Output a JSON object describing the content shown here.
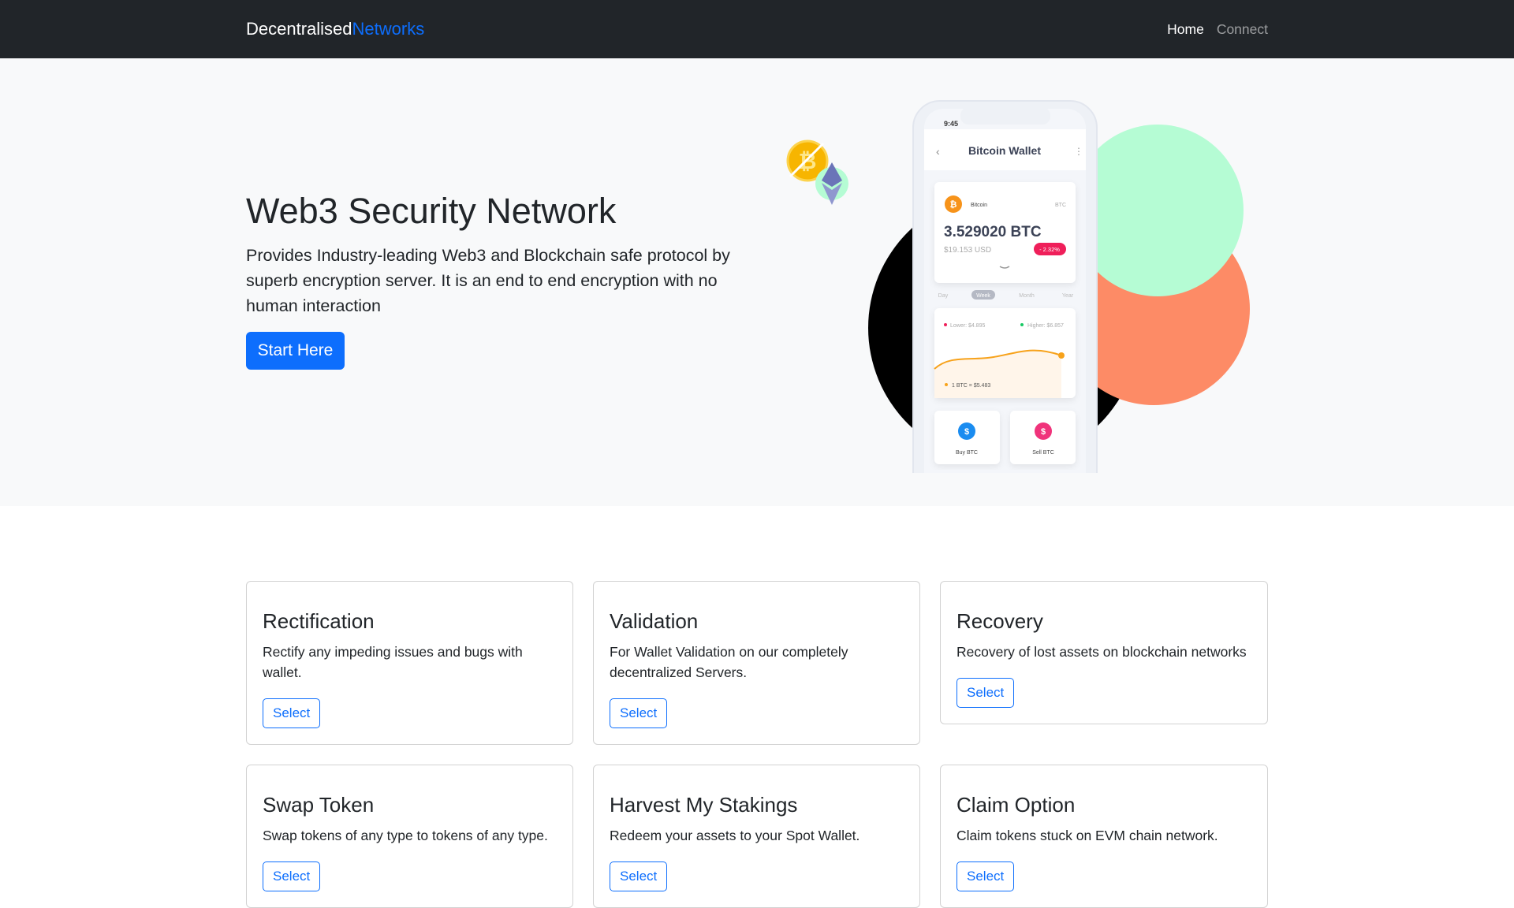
{
  "nav": {
    "brand_main": "Decentralised",
    "brand_accent": "Networks",
    "links": [
      "Home",
      "Connect"
    ]
  },
  "hero": {
    "title": "Web3 Security Network",
    "description": "Provides Industry-leading Web3 and Blockchain safe protocol by superb encryption server. It is an end to end encryption with no human interaction",
    "cta": "Start Here"
  },
  "phone": {
    "time": "9:45",
    "title": "Bitcoin Wallet",
    "coin_name": "Bitcoin",
    "coin_symbol": "BTC",
    "balance": "3.529020 BTC",
    "balance_usd": "$19.153 USD",
    "change": "- 2.32%",
    "periods": [
      "Day",
      "Week",
      "Month",
      "Year"
    ],
    "lower": "Lower: $4.895",
    "higher": "Higher: $6.857",
    "rate": "1 BTC = $5.483",
    "buy": "Buy BTC",
    "sell": "Sell BTC"
  },
  "cards": [
    {
      "title": "Rectification",
      "text": "Rectify any impeding issues and bugs with wallet.",
      "button": "Select"
    },
    {
      "title": "Validation",
      "text": "For Wallet Validation on our completely decentralized Servers.",
      "button": "Select"
    },
    {
      "title": "Recovery",
      "text": "Recovery of lost assets on blockchain networks",
      "button": "Select"
    },
    {
      "title": "Swap Token",
      "text": "Swap tokens of any type to tokens of any type.",
      "button": "Select"
    },
    {
      "title": "Harvest My Stakings",
      "text": "Redeem your assets to your Spot Wallet.",
      "button": "Select"
    },
    {
      "title": "Claim Option",
      "text": "Claim tokens stuck on EVM chain network.",
      "button": "Select"
    }
  ],
  "colors": {
    "primary": "#0d6efd",
    "navbar": "#212529",
    "hero_bg": "#f8f9fa",
    "green": "#b5fcd4",
    "orange": "#fd8b66"
  }
}
